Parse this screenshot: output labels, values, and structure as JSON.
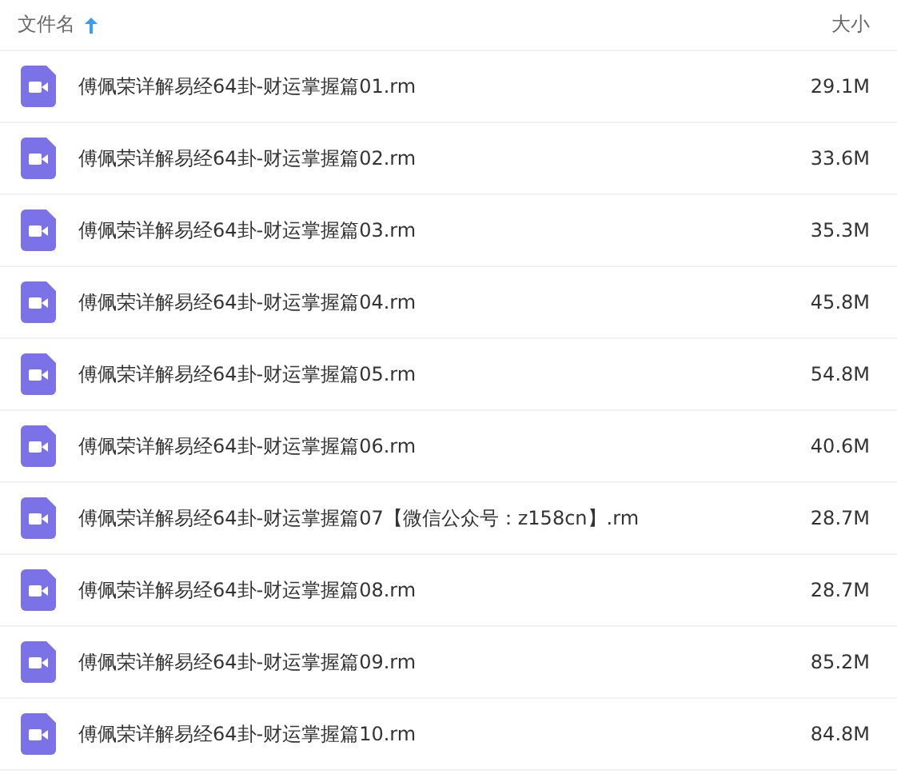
{
  "header": {
    "name_label": "文件名",
    "sort_ascending": true,
    "size_label": "大小"
  },
  "files": [
    {
      "name": "傅佩荣详解易经64卦-财运掌握篇01.rm",
      "size": "29.1M"
    },
    {
      "name": "傅佩荣详解易经64卦-财运掌握篇02.rm",
      "size": "33.6M"
    },
    {
      "name": "傅佩荣详解易经64卦-财运掌握篇03.rm",
      "size": "35.3M"
    },
    {
      "name": "傅佩荣详解易经64卦-财运掌握篇04.rm",
      "size": "45.8M"
    },
    {
      "name": "傅佩荣详解易经64卦-财运掌握篇05.rm",
      "size": "54.8M"
    },
    {
      "name": "傅佩荣详解易经64卦-财运掌握篇06.rm",
      "size": "40.6M"
    },
    {
      "name": "傅佩荣详解易经64卦-财运掌握篇07【微信公众号：z158cn】.rm",
      "size": "28.7M"
    },
    {
      "name": "傅佩荣详解易经64卦-财运掌握篇08.rm",
      "size": "28.7M"
    },
    {
      "name": "傅佩荣详解易经64卦-财运掌握篇09.rm",
      "size": "85.2M"
    },
    {
      "name": "傅佩荣详解易经64卦-财运掌握篇10.rm",
      "size": "84.8M"
    }
  ]
}
